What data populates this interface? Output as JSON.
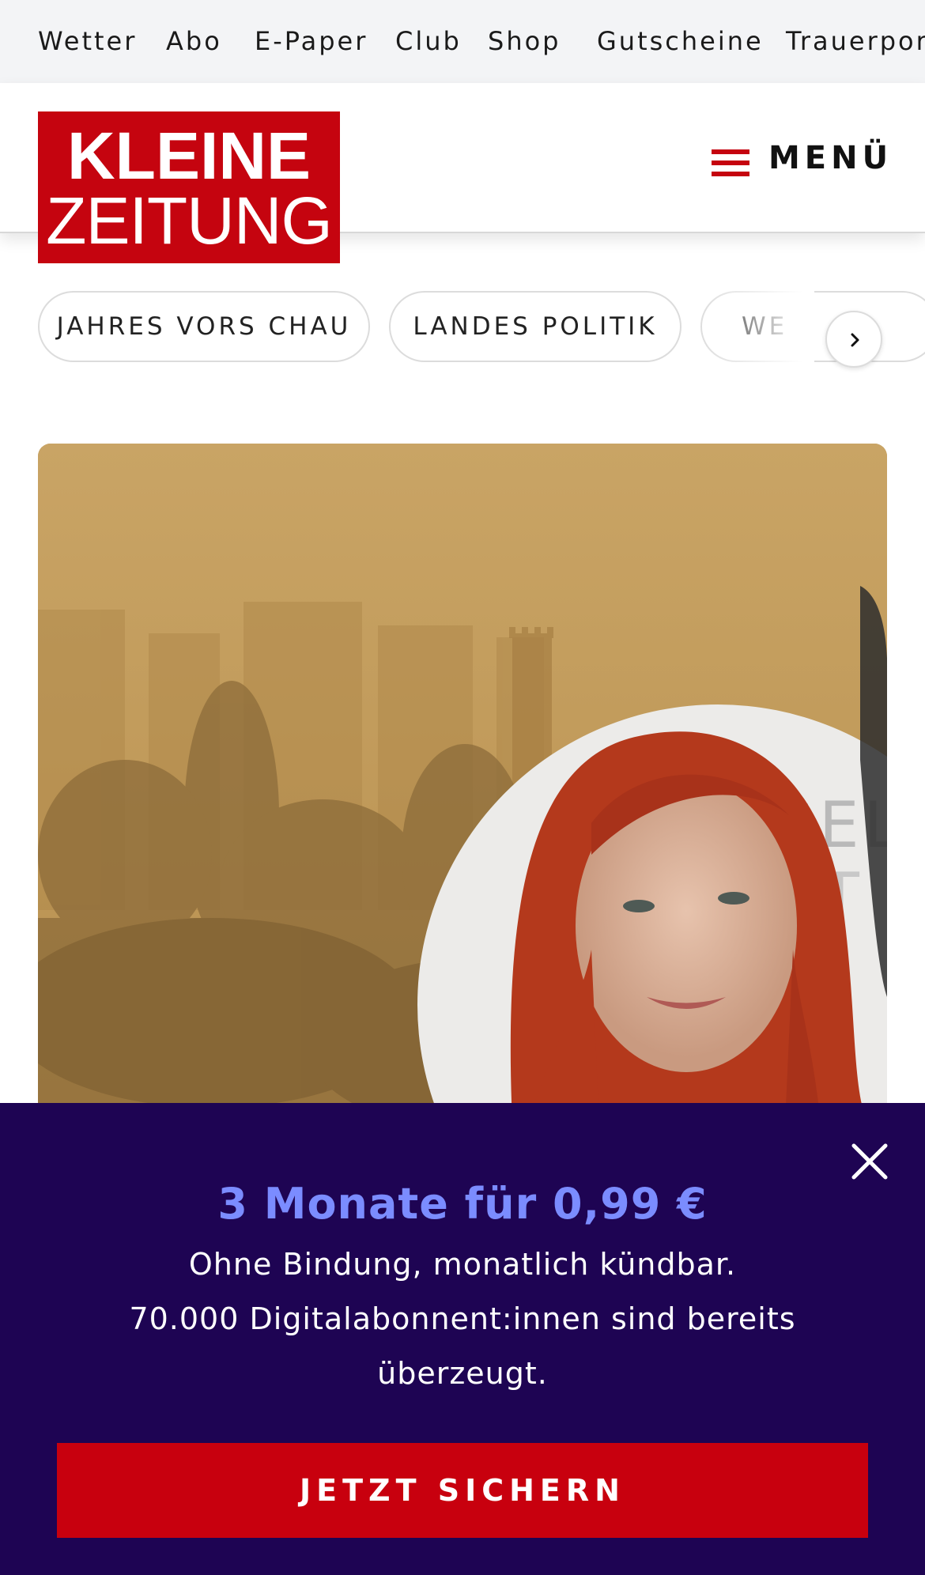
{
  "service_nav": [
    "Wetter",
    "Abo",
    "E-Paper",
    "Club",
    "Shop",
    "Gutscheine",
    "Trauerportal"
  ],
  "logo": {
    "line1": "KLEINE",
    "line2": "ZEITUNG",
    "color": "#c5040f"
  },
  "header": {
    "menu_label": "MENÜ",
    "menu_icon": "hamburger-icon"
  },
  "topics": [
    "JAHRES VORS CHAU",
    "LANDES POLITIK",
    "WE"
  ],
  "topics_next_icon": "chevron-right-icon",
  "offer": {
    "title": "3 Monate für 0,99 €",
    "line1": "Ohne Bindung, monatlich kündbar.",
    "line2": "70.000 Digitalabonnent:innen sind bereits",
    "line3": "überzeugt.",
    "cta": "JETZT SICHERN",
    "close_icon": "close-icon",
    "background": "#1e0453",
    "accent": "#7b8cff",
    "cta_color": "#c8000e"
  }
}
